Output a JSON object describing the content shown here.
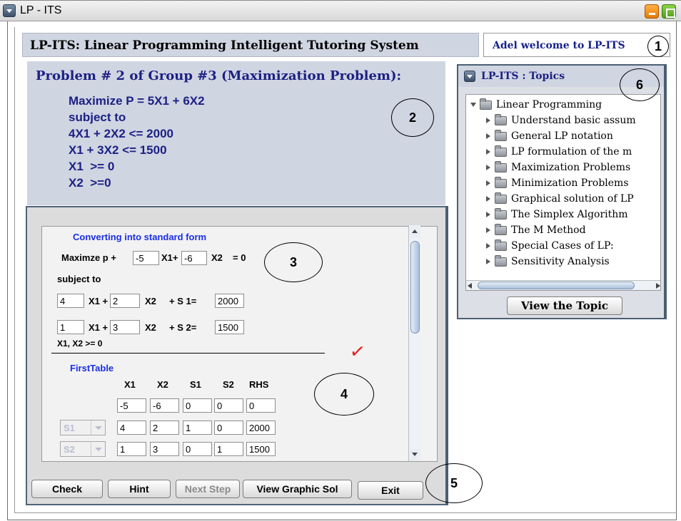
{
  "window": {
    "title": "LP - ITS"
  },
  "header": {
    "title": "LP-ITS: Linear Programming Intelligent Tutoring System",
    "welcome": "Adel welcome to LP-ITS"
  },
  "problem": {
    "title": "Problem # 2 of Group #3 (Maximization Problem):",
    "lines": [
      "Maximize P = 5X1 + 6X2",
      "subject to",
      "4X1 + 2X2 <= 2000",
      "X1 + 3X2 <= 1500",
      "X1  >= 0",
      "X2  >=0"
    ]
  },
  "workspace": {
    "section_title": "Converting into standard form",
    "objective": {
      "prefix": "Maximze p +",
      "c1": "-5",
      "x1": "X1+",
      "c2": "-6",
      "x2": "X2",
      "rhs": "= 0"
    },
    "subject_to": "subject to",
    "constraints": [
      {
        "a1": "4",
        "x1": "X1 +",
        "a2": "2",
        "x2": "X2",
        "slack": "+ S 1=",
        "rhs": "2000"
      },
      {
        "a1": "1",
        "x1": "X1 +",
        "a2": "3",
        "x2": "X2",
        "slack": "+ S 2=",
        "rhs": "1500"
      }
    ],
    "nonneg": "X1, X2 >= 0",
    "check_mark": "✓",
    "table": {
      "title": "FirstTable",
      "headers": [
        "X1",
        "X2",
        "S1",
        "S2",
        "RHS"
      ],
      "rows": [
        {
          "basis": "",
          "cells": [
            "-5",
            "-6",
            "0",
            "0",
            "0"
          ]
        },
        {
          "basis": "S1",
          "cells": [
            "4",
            "2",
            "1",
            "0",
            "2000"
          ]
        },
        {
          "basis": "S2",
          "cells": [
            "1",
            "3",
            "0",
            "1",
            "1500"
          ]
        }
      ]
    }
  },
  "buttons": {
    "check": "Check",
    "hint": "Hint",
    "next_step": "Next Step",
    "view_graphic": "View Graphic Sol",
    "exit": "Exit"
  },
  "topics": {
    "title": "LP-ITS : Topics",
    "root": "Linear Programming",
    "items": [
      "Understand basic assum",
      "General LP notation",
      "LP formulation of the m",
      "Maximization Problems",
      "Minimization Problems",
      "Graphical solution of LP",
      "The Simplex Algorithm",
      "The M Method",
      "Special Cases of LP:",
      "Sensitivity Analysis"
    ],
    "view_button": "View the Topic"
  },
  "callouts": [
    "1",
    "2",
    "3",
    "4",
    "5",
    "6"
  ],
  "colors": {
    "accent_navy": "#1c2184",
    "label_blue": "#1a2ee6",
    "panel_bg": "#d0d5e2",
    "check_red": "#e02020"
  }
}
